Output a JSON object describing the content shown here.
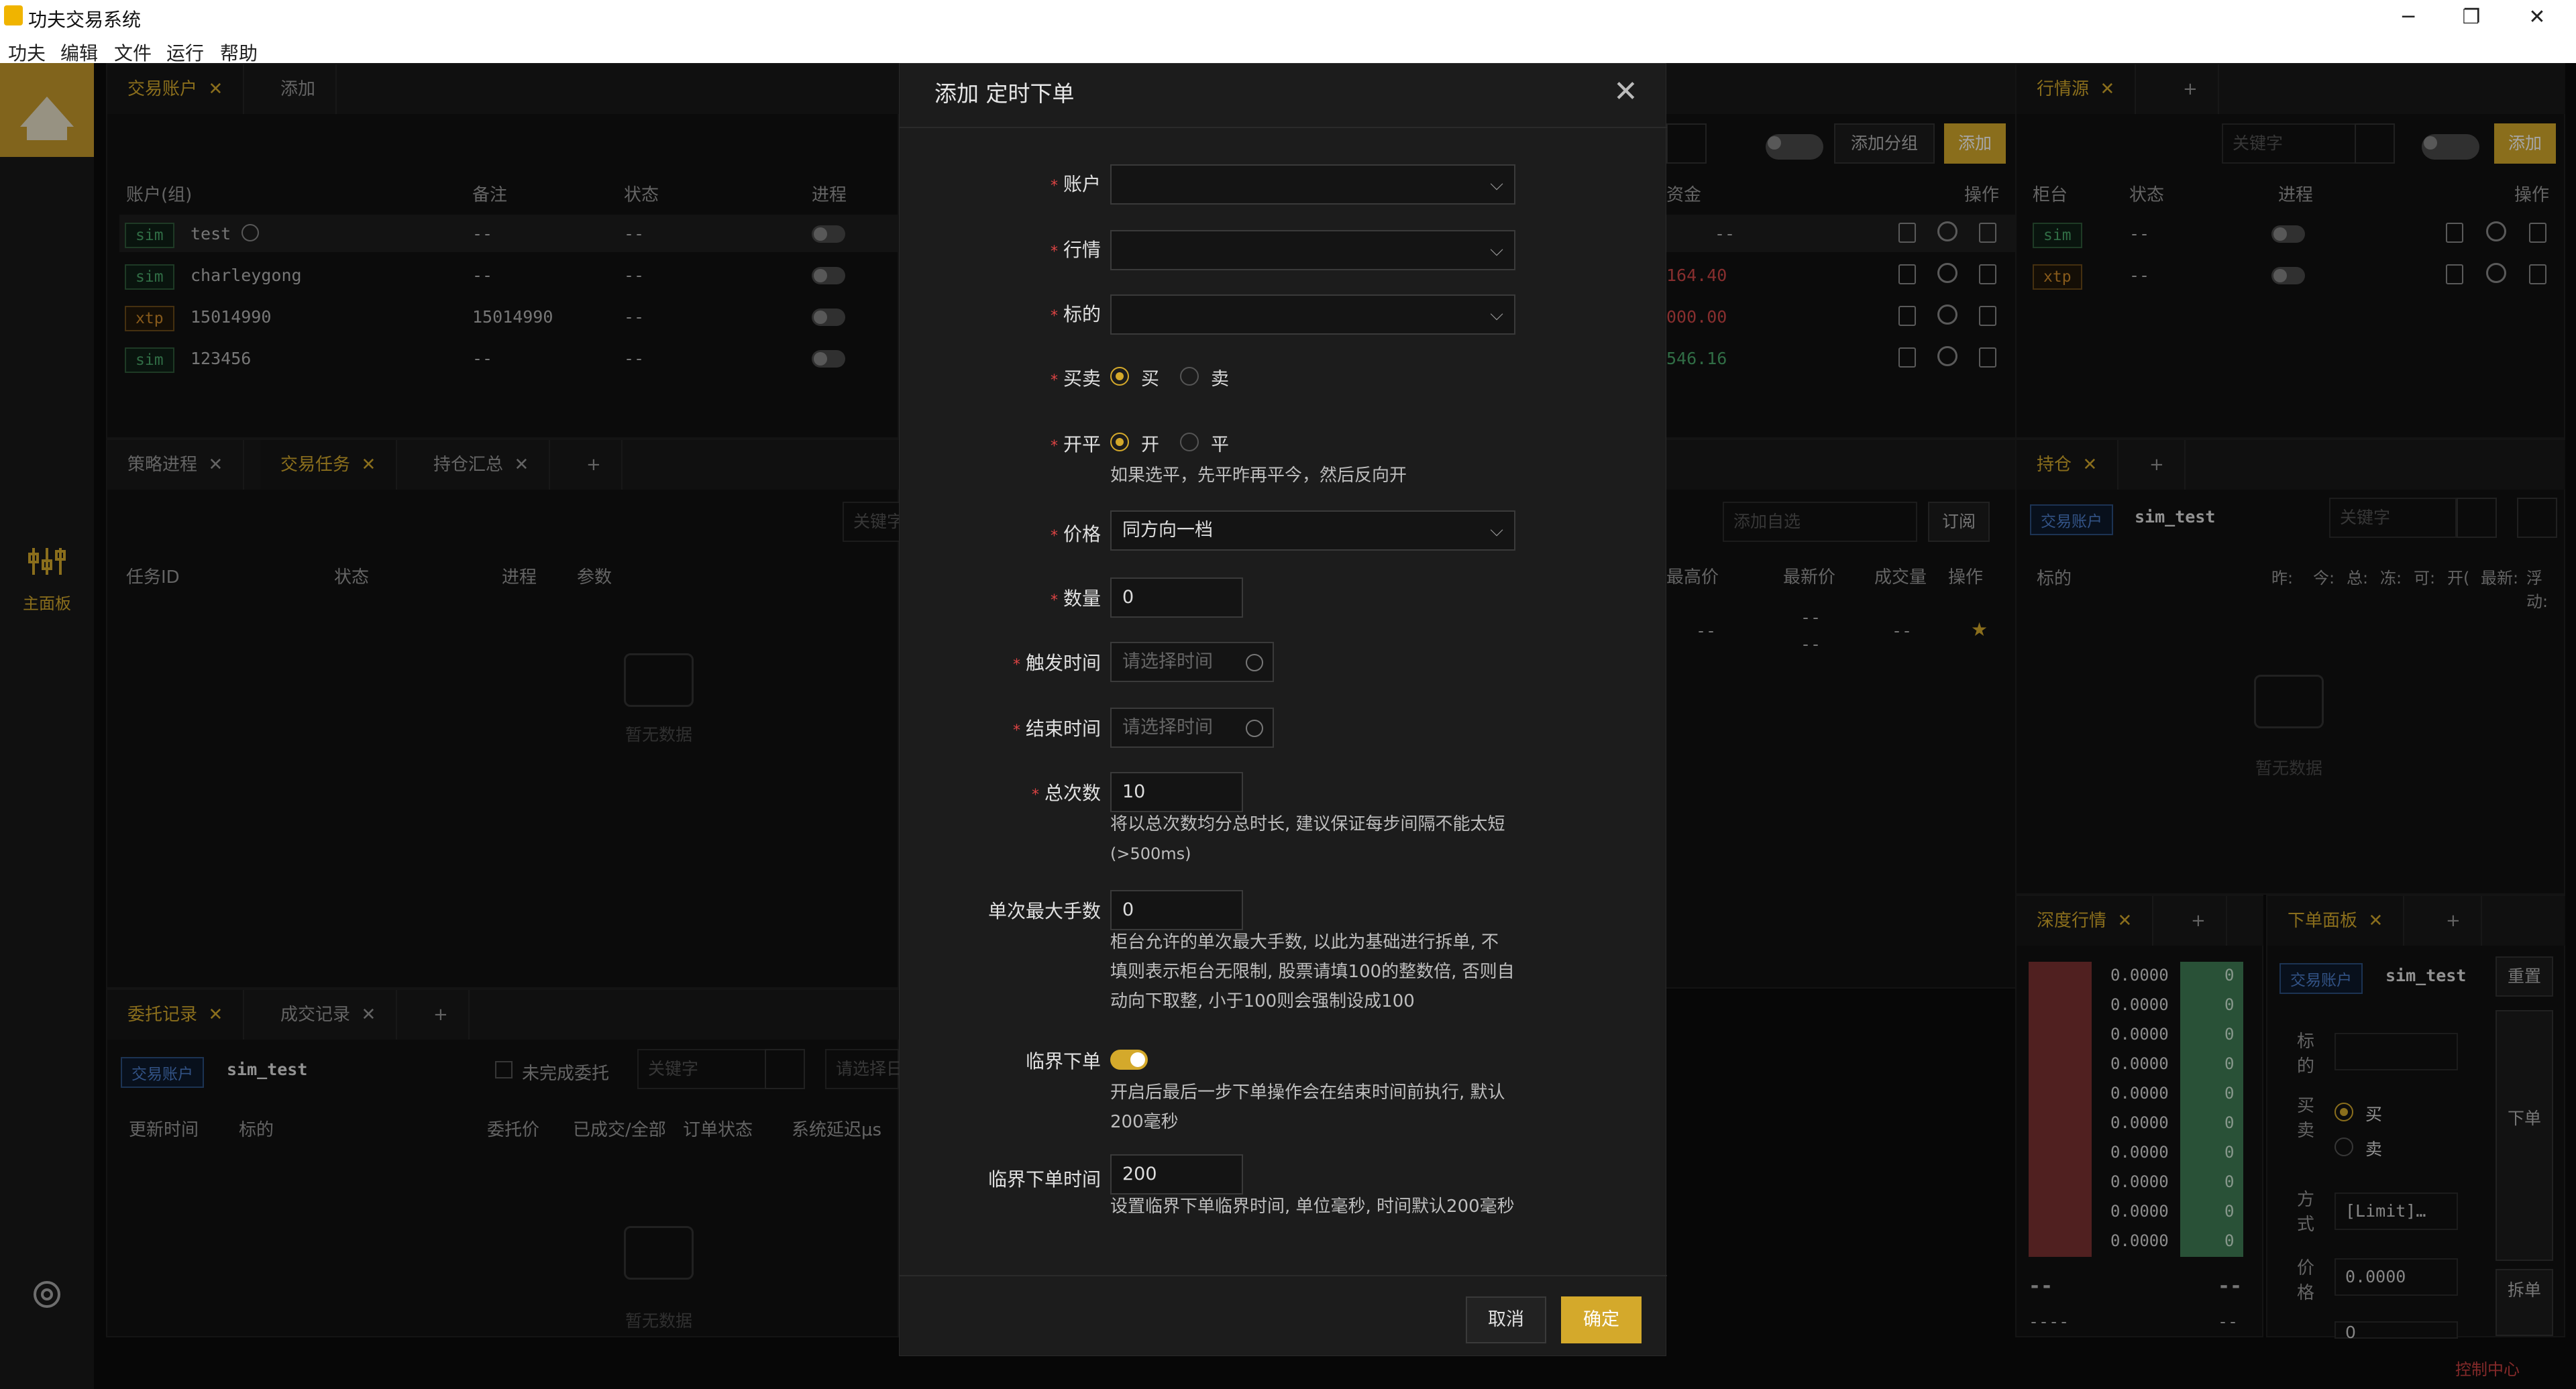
{
  "window": {
    "title": "功夫交易系统",
    "minimize": "─",
    "restore": "❐",
    "close": "✕"
  },
  "menu": [
    "功夫",
    "编辑",
    "文件",
    "运行",
    "帮助"
  ],
  "sidebar": {
    "main_panel": "主面板",
    "settings": "设置"
  },
  "accounts_panel": {
    "tab": "交易账户",
    "add": "添加",
    "close": "✕",
    "search_icon": "search-icon",
    "add_group": "添加分组",
    "columns": [
      "账户(组)",
      "备注",
      "状态",
      "进程",
      "资金"
    ],
    "ops": "操作",
    "rows": [
      {
        "tag": "sim",
        "name": "test",
        "note": "--",
        "status": "--",
        "fund": "--"
      },
      {
        "tag": "sim",
        "name": "charleygong",
        "note": "--",
        "status": "--",
        "fund": "164.40"
      },
      {
        "tag": "xtp",
        "name": "15014990",
        "note": "15014990",
        "status": "--",
        "fund": "000.00"
      },
      {
        "tag": "sim",
        "name": "123456",
        "note": "--",
        "status": "--",
        "fund": "546.16"
      }
    ]
  },
  "md_source_panel": {
    "tab": "行情源",
    "keyword_placeholder": "关键字",
    "add": "添加",
    "columns": [
      "柜台",
      "状态",
      "进程",
      "操作"
    ],
    "rows": [
      {
        "tag": "sim",
        "status": "--"
      },
      {
        "tag": "xtp",
        "status": "--"
      }
    ]
  },
  "strategy_panel": {
    "tabs": [
      "策略进程",
      "交易任务",
      "持仓汇总"
    ],
    "keyword": "关键字",
    "columns": [
      "任务ID",
      "状态",
      "进程",
      "参数"
    ],
    "empty": "暂无数据"
  },
  "market_panel": {
    "add_watch": "添加自选",
    "subscribe": "订阅",
    "columns": [
      "最高价",
      "最新价",
      "成交量",
      "操作"
    ],
    "row": {
      "high": "--",
      "last1": "--",
      "last2": "--",
      "vol": "--"
    }
  },
  "position_panel": {
    "tab": "持仓",
    "account_label": "交易账户",
    "account": "sim_test",
    "keyword": "关键字",
    "columns": [
      "标的",
      "昨:",
      "今:",
      "总:",
      "冻:",
      "可:",
      "开(",
      "最新:",
      "浮动:"
    ],
    "empty": "暂无数据"
  },
  "orders_panel": {
    "tabs": [
      "委托记录",
      "成交记录"
    ],
    "account_label": "交易账户",
    "account": "sim_test",
    "unfinished": "未完成委托",
    "keyword": "关键字",
    "select_placeholder": "请选择日",
    "columns": [
      "更新时间",
      "标的",
      "委托价",
      "已成交/全部",
      "订单状态",
      "系统延迟μs"
    ],
    "empty": "暂无数据"
  },
  "depth_panel": {
    "tab": "深度行情",
    "asks": [
      "0.0000",
      "0.0000",
      "0.0000",
      "0.0000",
      "0.0000",
      "0.0000",
      "0.0000",
      "0.0000",
      "0.0000",
      "0.0000"
    ],
    "vols": [
      "0",
      "0",
      "0",
      "0",
      "0",
      "0",
      "0",
      "0",
      "0",
      "0"
    ],
    "footer_left": "--",
    "footer_right": "--",
    "footer_left2": "----",
    "footer_right2": "--"
  },
  "order_panel": {
    "tab": "下单面板",
    "account_label": "交易账户",
    "account": "sim_test",
    "reset": "重置",
    "labels": [
      "标的",
      "买卖",
      "方式",
      "价格",
      "下单"
    ],
    "buy": "买",
    "sell": "卖",
    "mode": "[Limit]…",
    "price": "0.0000",
    "qty": "0",
    "place": "下单",
    "split": "拆单"
  },
  "status_bar": {
    "control_center": "控制中心"
  },
  "modal": {
    "title": "添加 定时下单",
    "close": "✕",
    "fields": {
      "account": {
        "label": "账户",
        "value": ""
      },
      "market": {
        "label": "行情",
        "value": ""
      },
      "instrument": {
        "label": "标的",
        "value": ""
      },
      "side": {
        "label": "买卖",
        "opt1": "买",
        "opt2": "卖"
      },
      "offset": {
        "label": "开平",
        "opt1": "开",
        "opt2": "平",
        "help": "如果选平，先平昨再平今，然后反向开"
      },
      "price": {
        "label": "价格",
        "value": "同方向一档"
      },
      "volume": {
        "label": "数量",
        "value": "0"
      },
      "trigger": {
        "label": "触发时间",
        "placeholder": "请选择时间"
      },
      "end": {
        "label": "结束时间",
        "placeholder": "请选择时间"
      },
      "total": {
        "label": "总次数",
        "value": "10",
        "help1": "将以总次数均分总时长, 建议保证每步间隔不能太短",
        "help2": "(>500ms)"
      },
      "max_lot": {
        "label": "单次最大手数",
        "value": "0",
        "help1": "柜台允许的单次最大手数, 以此为基础进行拆单, 不",
        "help2": "填则表示柜台无限制, 股票请填100的整数倍, 否则自",
        "help3": "动向下取整, 小于100则会强制设成100"
      },
      "critical": {
        "label": "临界下单",
        "help1": "开启后最后一步下单操作会在结束时间前执行, 默认",
        "help2": "200毫秒"
      },
      "critical_time": {
        "label": "临界下单时间",
        "value": "200",
        "help": "设置临界下单临界时间, 单位毫秒, 时间默认200毫秒"
      }
    },
    "cancel": "取消",
    "ok": "确定"
  }
}
